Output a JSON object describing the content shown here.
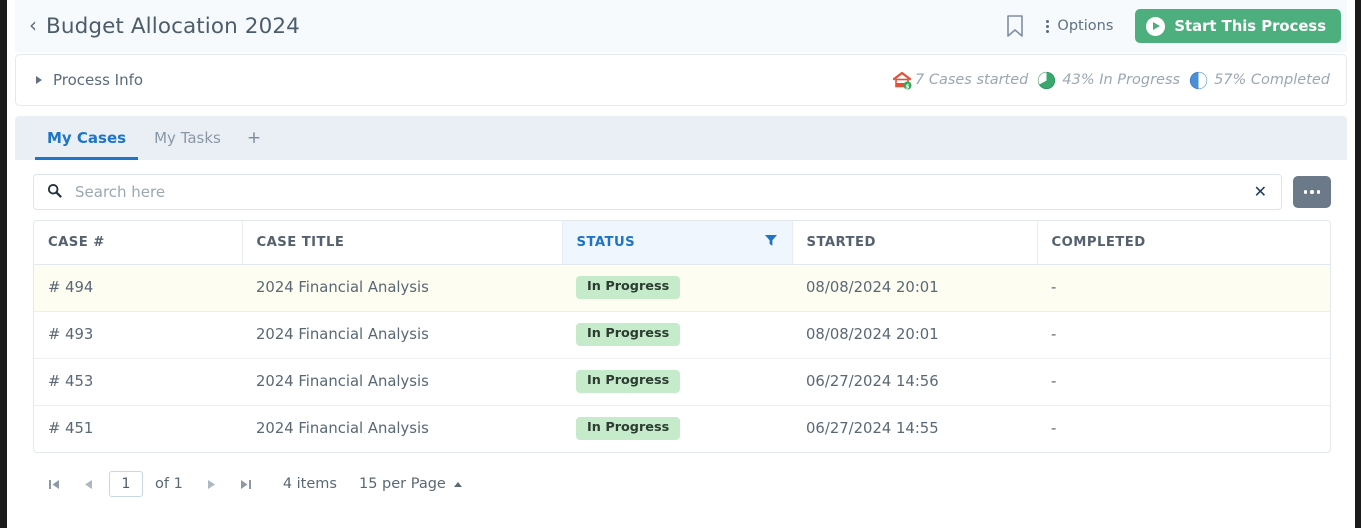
{
  "header": {
    "back_icon": "chevron-left-icon",
    "title": "Budget Allocation 2024",
    "bookmark_icon": "bookmark-icon",
    "options_label": "Options",
    "options_icon": "vertical-dots-icon",
    "start_button_label": "Start This Process",
    "start_button_icon": "play-circle-icon",
    "start_button_color": "#4caf7d"
  },
  "process_info": {
    "label": "Process Info",
    "expand_icon": "triangle-right-icon",
    "collapsed": true,
    "stats": [
      {
        "icon": "cases-started-icon",
        "text": "7 Cases started",
        "color": "#e05a3c"
      },
      {
        "icon": "pie-chart-green-icon",
        "text": "43% In Progress",
        "color": "#3aa76d",
        "percent": 43
      },
      {
        "icon": "pie-chart-blue-icon",
        "text": "57% Completed",
        "color": "#4a90d9",
        "percent": 57
      }
    ]
  },
  "tabs": {
    "items": [
      {
        "label": "My Cases",
        "active": true
      },
      {
        "label": "My Tasks",
        "active": false
      }
    ],
    "add_tab_icon": "plus-icon",
    "add_tab_label": "+",
    "active_color": "#1e74c6"
  },
  "search": {
    "icon": "search-icon",
    "placeholder": "Search here",
    "value": "",
    "clear_icon": "close-x-icon",
    "clear_label": "✕",
    "more_icon": "horizontal-dots-icon"
  },
  "table": {
    "columns": [
      {
        "label": "CASE #",
        "filtered": false
      },
      {
        "label": "CASE TITLE",
        "filtered": false
      },
      {
        "label": "STATUS",
        "filtered": true,
        "filter_icon": "funnel-icon"
      },
      {
        "label": "STARTED",
        "filtered": false
      },
      {
        "label": "COMPLETED",
        "filtered": false
      }
    ],
    "rows": [
      {
        "case_number": "# 494",
        "case_title": "2024 Financial Analysis",
        "status": "In Progress",
        "started": "08/08/2024 20:01",
        "completed": "-",
        "highlighted": true
      },
      {
        "case_number": "# 493",
        "case_title": "2024 Financial Analysis",
        "status": "In Progress",
        "started": "08/08/2024 20:01",
        "completed": "-",
        "highlighted": false
      },
      {
        "case_number": "# 453",
        "case_title": "2024 Financial Analysis",
        "status": "In Progress",
        "started": "06/27/2024 14:56",
        "completed": "-",
        "highlighted": false
      },
      {
        "case_number": "# 451",
        "case_title": "2024 Financial Analysis",
        "status": "In Progress",
        "started": "06/27/2024 14:55",
        "completed": "-",
        "highlighted": false
      }
    ],
    "status_pill_color": "#c6ebcb"
  },
  "pagination": {
    "first_icon": "first-page-icon",
    "prev_icon": "prev-page-icon",
    "page_value": "1",
    "of_label": "of 1",
    "next_icon": "next-page-icon",
    "last_icon": "last-page-icon",
    "items_label": "4 items",
    "per_page_label": "15 per Page",
    "per_page_icon": "caret-up-icon"
  }
}
